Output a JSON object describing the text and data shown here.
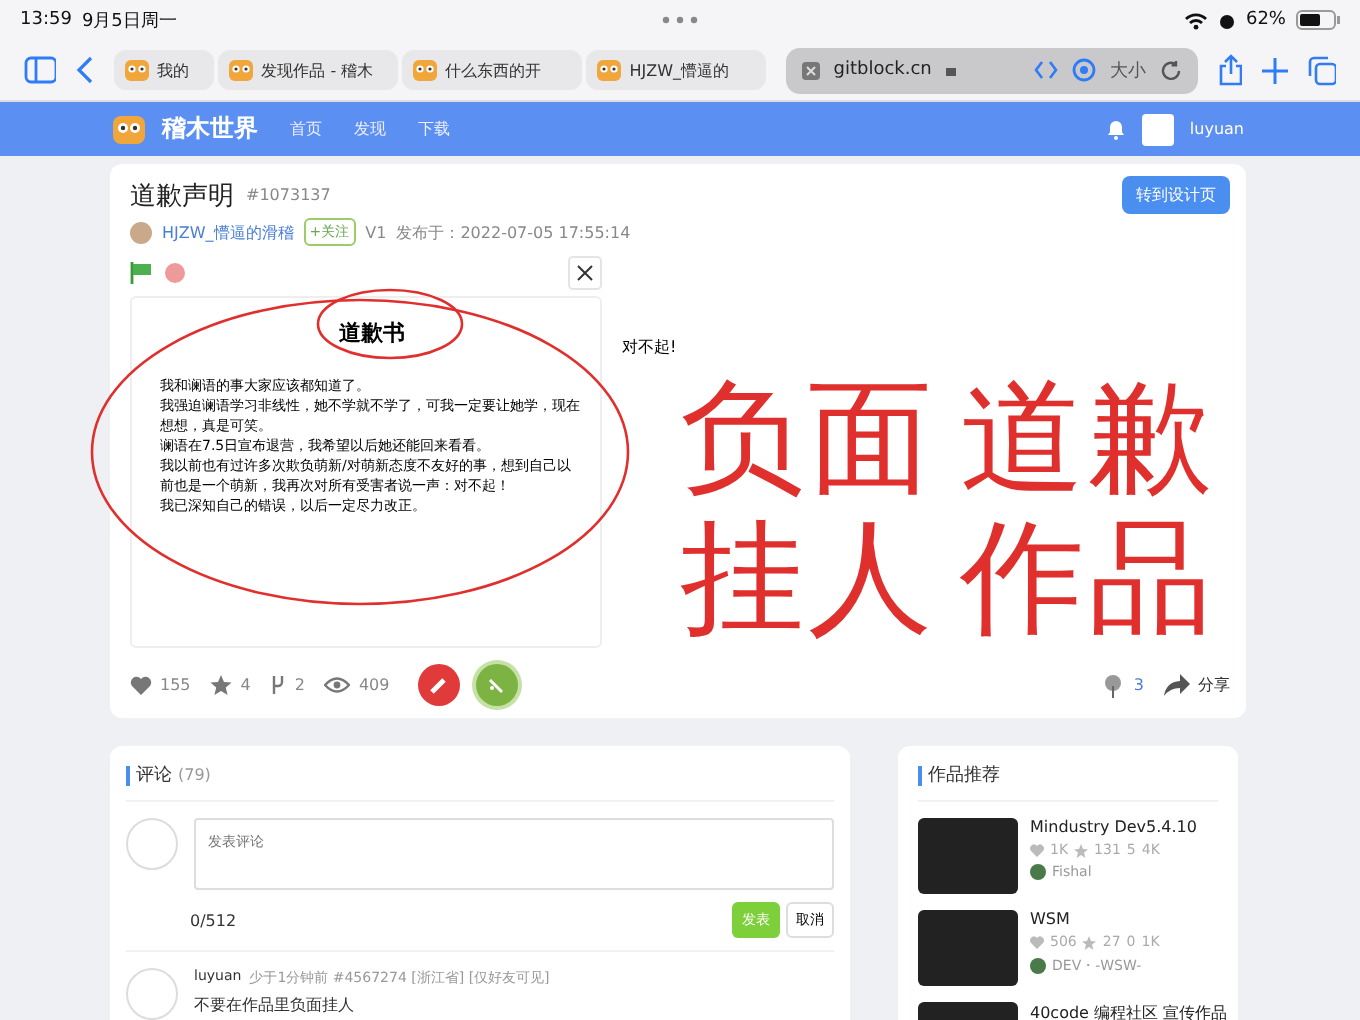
{
  "status_bar": {
    "time": "13:59",
    "date": "9月5日周一",
    "battery": "62%"
  },
  "browser": {
    "tabs": [
      {
        "title": "我的",
        "selected": false
      },
      {
        "title": "发现作品 - 稽木",
        "selected": false
      },
      {
        "title": "什么东西的开",
        "selected": false
      },
      {
        "title": "HJZW_懵逼的",
        "selected": false
      }
    ],
    "address": {
      "url": "gitblock.cn",
      "text_size": "大小"
    }
  },
  "site_nav": {
    "logo": "稽木世界",
    "links": [
      "首页",
      "发现",
      "下载"
    ],
    "user": "luyuan"
  },
  "post": {
    "title": "道歉声明",
    "id": "#1073137",
    "author": "HJZW_懵逼的滑稽",
    "follow": "+关注",
    "version": "V1",
    "published": "发布于：2022-07-05 17:55:14",
    "design_button": "转到设计页",
    "stage": {
      "heading": "道歉书",
      "paragraphs": [
        "我和谰语的事大家应该都知道了。",
        "我强迫谰语学习非线性，她不学就不学了，可我一定要让她学，现在想想，真是可笑。",
        "谰语在7.5日宣布退营，我希望以后她还能回来看看。",
        "我以前也有过许多次欺负萌新/对萌新态度不友好的事，想到自己以前也是一个萌新，我再次对所有受害者说一声：对不起！",
        "我已深知自己的错误，以后一定尽力改正。"
      ],
      "side_text": "对不起!"
    },
    "stats": {
      "likes": "155",
      "stars": "4",
      "forks": "2",
      "views": "409",
      "remixes": "3",
      "share": "分享"
    }
  },
  "comments": {
    "title": "评论",
    "count": "(79)",
    "placeholder": "发表评论",
    "counter": "0/512",
    "submit": "发表",
    "cancel": "取消",
    "items": [
      {
        "user": "luyuan",
        "meta": "少于1分钟前 #4567274 [浙江省] [仅好友可见]",
        "text": "不要在作品里负面挂人"
      }
    ]
  },
  "recommendations": {
    "title": "作品推荐",
    "items": [
      {
        "title": "Mindustry Dev5.4.10",
        "likes": "1K",
        "stars": "131",
        "forks": "5",
        "views": "4K",
        "author": "Fishal"
      },
      {
        "title": "WSM",
        "likes": "506",
        "stars": "27",
        "forks": "0",
        "views": "1K",
        "author": "DEV・-WSW-"
      },
      {
        "title": "40code 编程社区 宣传作品"
      }
    ]
  },
  "annotation": {
    "handwriting": [
      "负面",
      "道歉",
      "挂人",
      "作品"
    ]
  }
}
